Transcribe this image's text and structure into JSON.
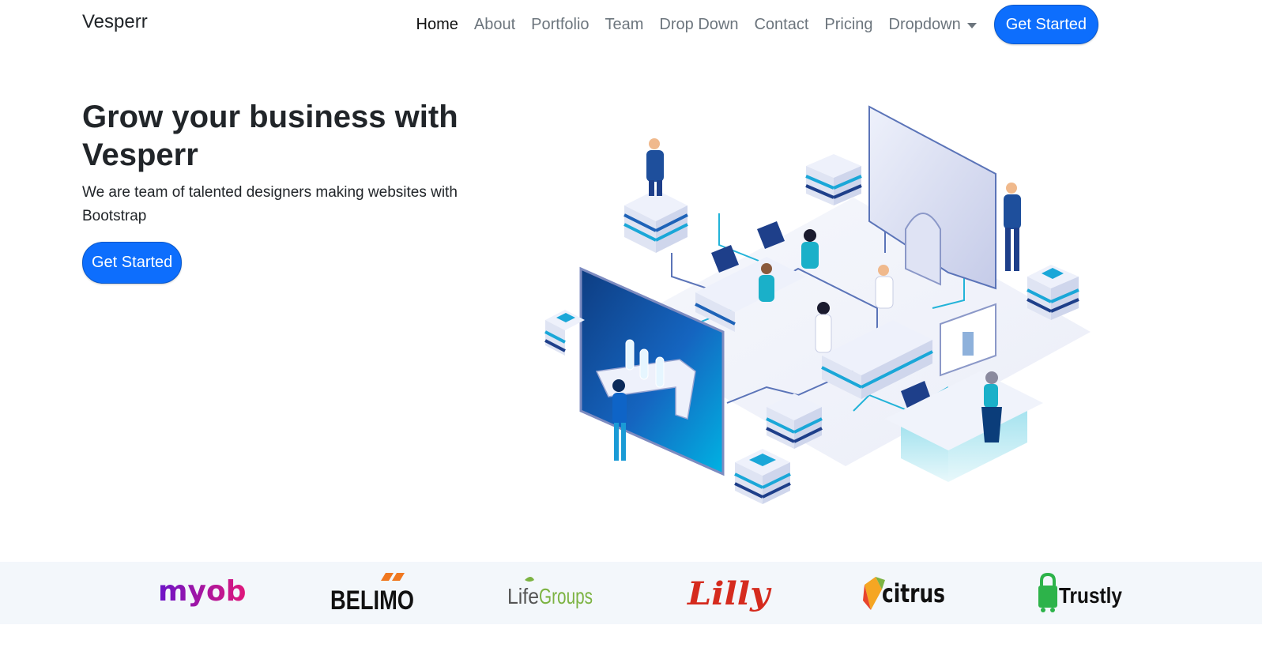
{
  "navbar": {
    "brand": "Vesperr",
    "links": [
      {
        "label": "Home"
      },
      {
        "label": "About"
      },
      {
        "label": "Portfolio"
      },
      {
        "label": "Team"
      },
      {
        "label": "Drop Down"
      },
      {
        "label": "Contact"
      },
      {
        "label": "Pricing"
      },
      {
        "label": "Dropdown"
      }
    ],
    "cta_label": "Get Started"
  },
  "hero": {
    "title": "Grow your business with Vesperr",
    "subtitle": "We are team of talented designers making websites with Bootstrap",
    "cta_label": "Get Started"
  },
  "clients": {
    "logos": [
      {
        "name": "myob",
        "color": "#8a1cc4"
      },
      {
        "name": "BELIMO",
        "color": "#111111",
        "accent": "#f07820"
      },
      {
        "name": "LifeGroups",
        "color": "#555555",
        "accent": "#7cb342"
      },
      {
        "name": "Lilly",
        "color": "#d52b1e"
      },
      {
        "name": "citrus",
        "color": "#111111"
      },
      {
        "name": "Trustly",
        "color": "#111111",
        "accent": "#2db34a"
      }
    ]
  },
  "colors": {
    "primary": "#0d6efd",
    "nav_text": "#6c757d",
    "clients_bg": "#f3f7fb"
  }
}
